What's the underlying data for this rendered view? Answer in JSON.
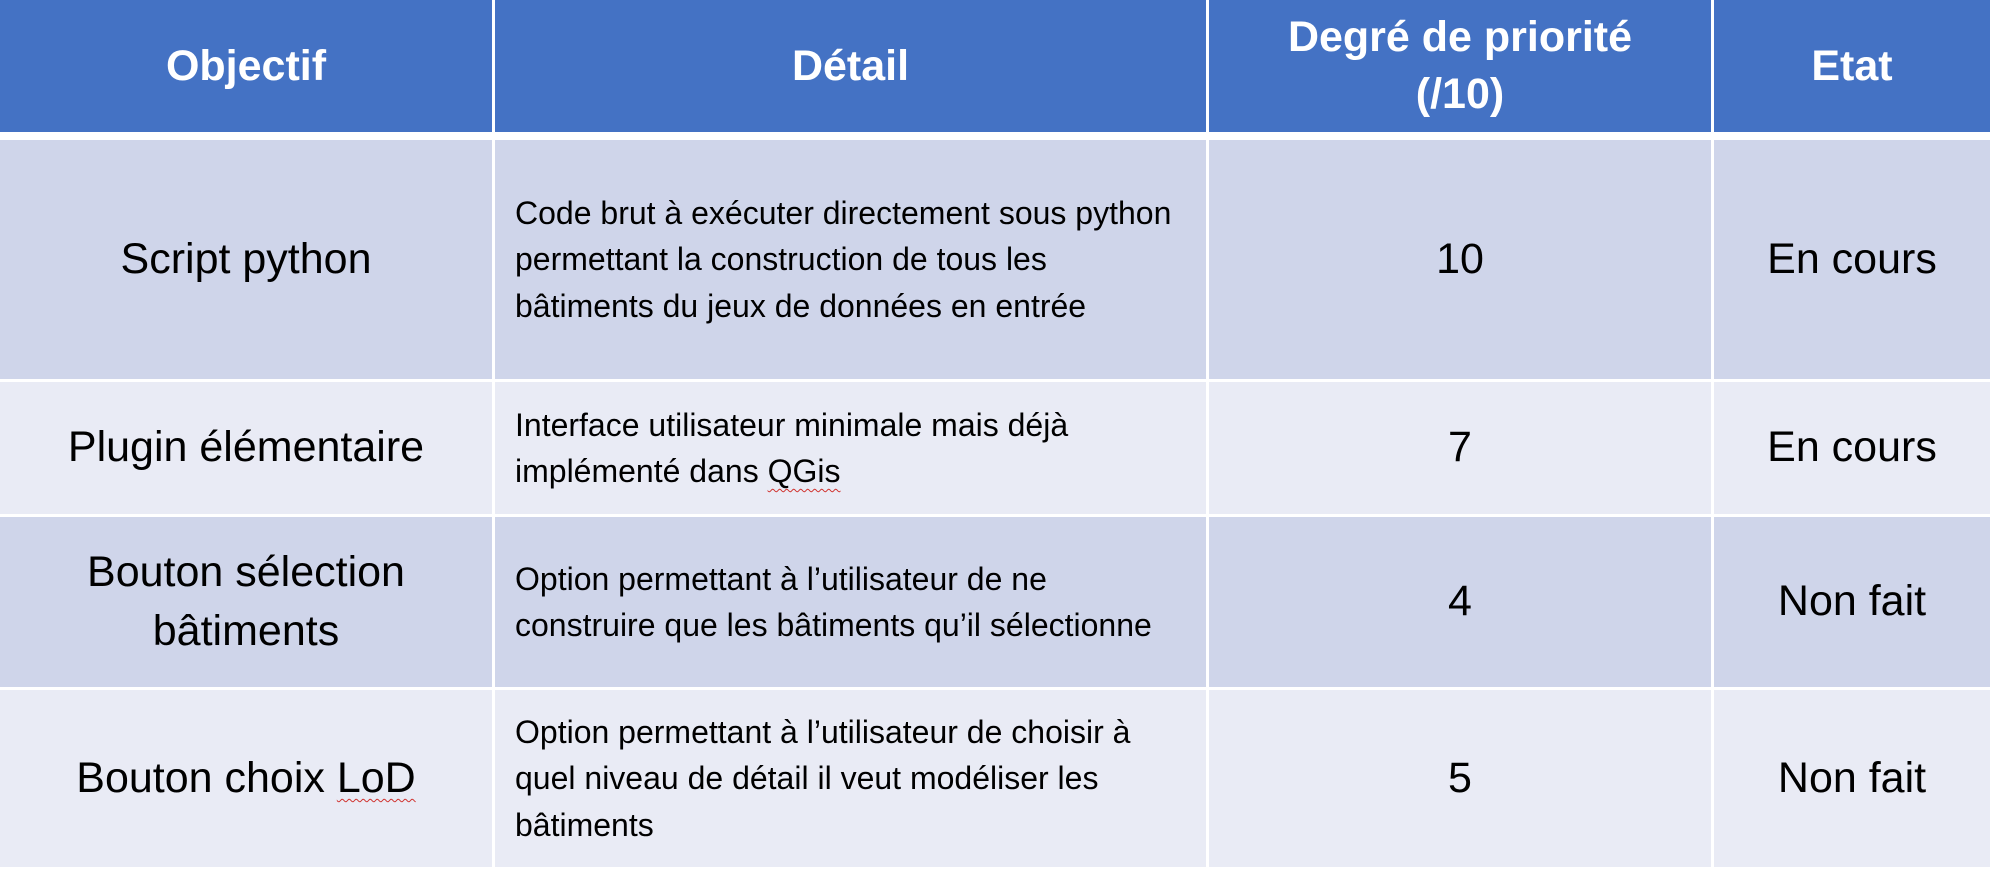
{
  "table": {
    "headers": {
      "objectif": "Objectif",
      "detail": "Détail",
      "priorite_line1": "Degré de priorité",
      "priorite_line2": "(/10)",
      "etat": "Etat"
    },
    "rows": [
      {
        "objectif": "Script python",
        "detail": "Code brut à exécuter directement sous python permettant la construction de tous les bâtiments du jeux de données en entrée",
        "priorite": "10",
        "etat": "En cours"
      },
      {
        "objectif": "Plugin élémentaire",
        "detail_prefix": "Interface utilisateur minimale mais déjà implémenté dans ",
        "detail_squiggle": "QGis",
        "priorite": "7",
        "etat": "En cours"
      },
      {
        "objectif_line1": "Bouton sélection",
        "objectif_line2": "bâtiments",
        "detail": "Option permettant à l’utilisateur de ne construire que les bâtiments qu’il sélectionne",
        "priorite": "4",
        "etat": "Non fait"
      },
      {
        "objectif_prefix": "Bouton choix ",
        "objectif_squiggle": "LoD",
        "detail": "Option permettant à l’utilisateur de choisir à quel niveau de détail il veut modéliser les bâtiments",
        "priorite": "5",
        "etat": "Non fait"
      }
    ]
  },
  "colors": {
    "header_bg": "#4472c4",
    "row_dark": "#cfd5ea",
    "row_light": "#e9ebf5",
    "spellcheck_underline": "#d0312d"
  }
}
